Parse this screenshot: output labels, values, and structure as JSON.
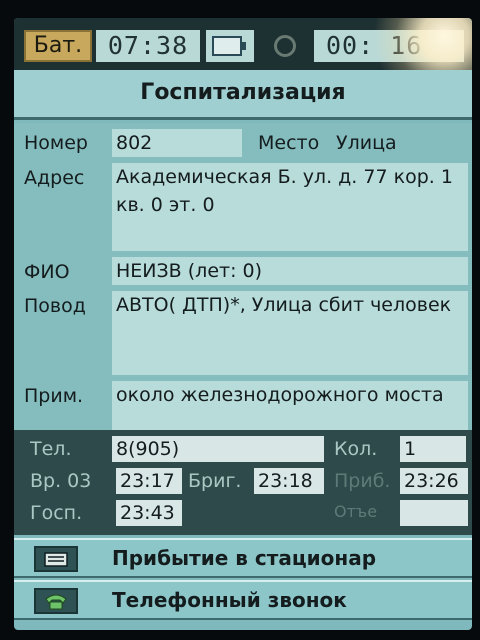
{
  "statusbar": {
    "battery_label": "Бат.",
    "clock": "07:38",
    "battery_icon": "battery-icon",
    "sync_icon": "sync-icon",
    "timer": "00: 16"
  },
  "title": "Госпитализация",
  "form": {
    "number_label": "Номер",
    "number_value": "802",
    "place_label": "Место",
    "place_value": "Улица",
    "address_label": "Адрес",
    "address_value": "Академическая Б. ул. д. 77 кор. 1 кв. 0 эт. 0",
    "fio_label": "ФИО",
    "fio_value": "НЕИЗВ (лет: 0)",
    "reason_label": "Повод",
    "reason_value": "АВТО( ДТП)*, Улица  сбит человек",
    "note_label": "Прим.",
    "note_value": "около  железнодорожного моста",
    "phone_label": "Тел.",
    "phone_value": "8(905)",
    "count_label": "Кол.",
    "count_value": "1",
    "time03_label": "Вр. 03",
    "time03_value": "23:17",
    "brig_label": "Бриг.",
    "brig_value": "23:18",
    "arrive_label": "Приб.",
    "arrive_value": "23:26",
    "hosp_label": "Госп.",
    "hosp_value": "23:43",
    "otezd_label": "Отъе",
    "otezd_value": ""
  },
  "buttons": [
    {
      "label": "Прибытие в стационар",
      "icon": "hospital-arrival-icon"
    },
    {
      "label": "Телефонный звонок",
      "icon": "phone-icon"
    }
  ],
  "colors": {
    "screen_bg": "#7fb9bd",
    "field_bg": "#b8dcda",
    "status_bar": "#1d3032",
    "battery_label_bg": "#c8a85c"
  }
}
